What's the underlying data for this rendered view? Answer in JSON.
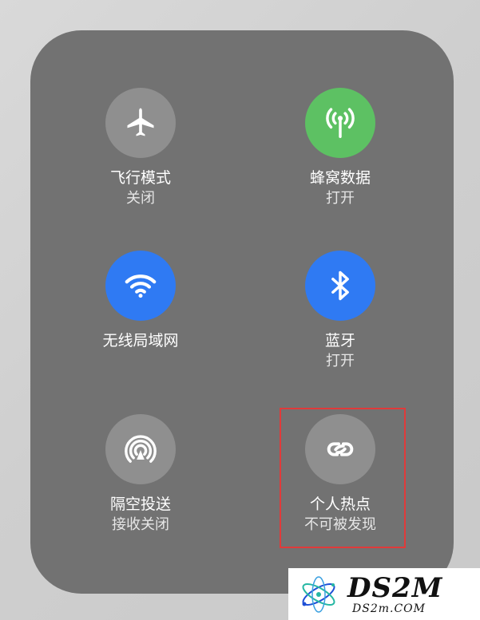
{
  "controls": [
    {
      "key": "airplane",
      "label": "飞行模式",
      "status": "关闭",
      "icon": "airplane-icon",
      "color": "#8f8f8f"
    },
    {
      "key": "cellular",
      "label": "蜂窝数据",
      "status": "打开",
      "icon": "antenna-icon",
      "color": "#5dc163"
    },
    {
      "key": "wifi",
      "label": "无线局域网",
      "status": "",
      "icon": "wifi-icon",
      "color": "#2f7af3"
    },
    {
      "key": "bluetooth",
      "label": "蓝牙",
      "status": "打开",
      "icon": "bluetooth-icon",
      "color": "#2f7af3"
    },
    {
      "key": "airdrop",
      "label": "隔空投送",
      "status": "接收关闭",
      "icon": "airdrop-icon",
      "color": "#8f8f8f"
    },
    {
      "key": "hotspot",
      "label": "个人热点",
      "status": "不可被发现",
      "icon": "hotspot-link-icon",
      "color": "#8f8f8f"
    }
  ],
  "highlight": {
    "color": "#e03a3a",
    "target": "hotspot"
  },
  "watermark": {
    "text": "DS2M",
    "subtext": "DS2m.COM",
    "icon": "atom-logo-icon"
  }
}
